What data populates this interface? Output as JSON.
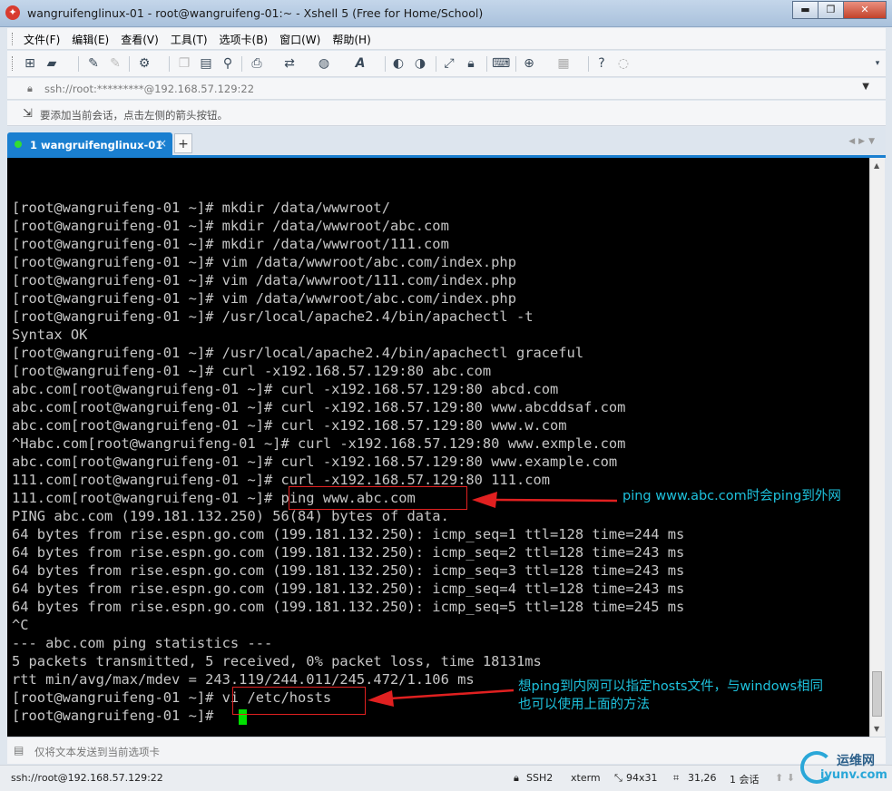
{
  "window": {
    "title": "wangruifenglinux-01 - root@wangruifeng-01:~ - Xshell 5 (Free for Home/School)",
    "app_icon": "xshell-icon"
  },
  "menu": [
    "文件(F)",
    "编辑(E)",
    "查看(V)",
    "工具(T)",
    "选项卡(B)",
    "窗口(W)",
    "帮助(H)"
  ],
  "address": {
    "text": "ssh://root:*********@192.168.57.129:22"
  },
  "hint": {
    "text": "要添加当前会话，点击左侧的箭头按钮。"
  },
  "tab": {
    "label": "1 wangruifenglinux-01",
    "close": "×",
    "new": "+"
  },
  "terminal": {
    "lines": [
      "[root@wangruifeng-01 ~]# mkdir /data/wwwroot/",
      "[root@wangruifeng-01 ~]# mkdir /data/wwwroot/abc.com",
      "[root@wangruifeng-01 ~]# mkdir /data/wwwroot/111.com",
      "[root@wangruifeng-01 ~]# vim /data/wwwroot/abc.com/index.php",
      "[root@wangruifeng-01 ~]# vim /data/wwwroot/111.com/index.php",
      "[root@wangruifeng-01 ~]# vim /data/wwwroot/abc.com/index.php",
      "[root@wangruifeng-01 ~]# /usr/local/apache2.4/bin/apachectl -t",
      "Syntax OK",
      "[root@wangruifeng-01 ~]# /usr/local/apache2.4/bin/apachectl graceful",
      "[root@wangruifeng-01 ~]# curl -x192.168.57.129:80 abc.com",
      "abc.com[root@wangruifeng-01 ~]# curl -x192.168.57.129:80 abcd.com",
      "abc.com[root@wangruifeng-01 ~]# curl -x192.168.57.129:80 www.abcddsaf.com",
      "abc.com[root@wangruifeng-01 ~]# curl -x192.168.57.129:80 www.w.com",
      "^Habc.com[root@wangruifeng-01 ~]# curl -x192.168.57.129:80 www.exmple.com",
      "abc.com[root@wangruifeng-01 ~]# curl -x192.168.57.129:80 www.example.com",
      "111.com[root@wangruifeng-01 ~]# curl -x192.168.57.129:80 111.com",
      "111.com[root@wangruifeng-01 ~]# ping www.abc.com",
      "PING abc.com (199.181.132.250) 56(84) bytes of data.",
      "64 bytes from rise.espn.go.com (199.181.132.250): icmp_seq=1 ttl=128 time=244 ms",
      "64 bytes from rise.espn.go.com (199.181.132.250): icmp_seq=2 ttl=128 time=243 ms",
      "64 bytes from rise.espn.go.com (199.181.132.250): icmp_seq=3 ttl=128 time=243 ms",
      "64 bytes from rise.espn.go.com (199.181.132.250): icmp_seq=4 ttl=128 time=243 ms",
      "64 bytes from rise.espn.go.com (199.181.132.250): icmp_seq=5 ttl=128 time=245 ms",
      "^C",
      "--- abc.com ping statistics ---",
      "5 packets transmitted, 5 received, 0% packet loss, time 18131ms",
      "rtt min/avg/max/mdev = 243.119/244.011/245.472/1.106 ms",
      "[root@wangruifeng-01 ~]# vi /etc/hosts",
      "[root@wangruifeng-01 ~]# "
    ]
  },
  "annotations": {
    "note1": "ping www.abc.com时会ping到外网",
    "note2_line1": "想ping到内网可以指定hosts文件，与windows相同",
    "note2_line2": "也可以使用上面的方法",
    "arrow_color": "#e02020",
    "text_color": "#1ec2dd"
  },
  "sendbar": {
    "text": "仅将文本发送到当前选项卡"
  },
  "status": {
    "session": "ssh://root@192.168.57.129:22",
    "protocol": "SSH2",
    "term": "xterm",
    "size": "94x31",
    "cursor": "31,26",
    "sessions": "1 会话",
    "watermark_cn": "运维网",
    "watermark_en": "iyunv.com"
  },
  "colors": {
    "tab_accent": "#1a7fd0",
    "cursor": "#00e000",
    "terminal_bg": "#000000",
    "terminal_fg": "#c6c6c6"
  }
}
